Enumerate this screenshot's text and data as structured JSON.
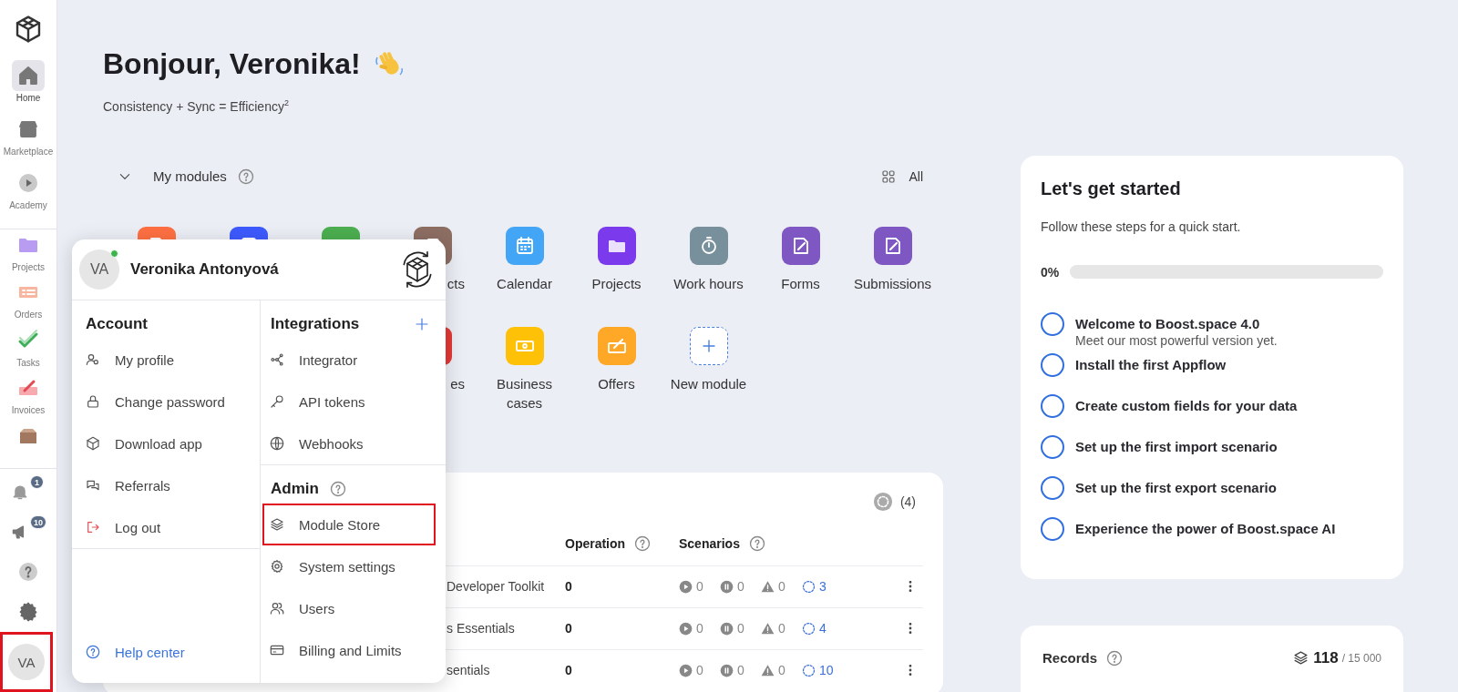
{
  "sidebar": {
    "items": [
      {
        "label": "Home",
        "selected": true
      },
      {
        "label": "Marketplace",
        "selected": false
      },
      {
        "label": "Academy",
        "selected": false
      },
      {
        "label": "Projects",
        "selected": false
      },
      {
        "label": "Orders",
        "selected": false
      },
      {
        "label": "Tasks",
        "selected": false
      },
      {
        "label": "Invoices",
        "selected": false
      },
      {
        "selected": false
      }
    ],
    "notifications_badge": "1",
    "announcements_badge": "10",
    "avatar": {
      "initials": "VA",
      "highlighted": true
    }
  },
  "greeting": {
    "title": "Bonjour, Veronika!",
    "subtitle": "Consistency + Sync = Efficiency$^{2}$"
  },
  "modules": {
    "title": "My modules",
    "expanded": true,
    "all_link": "All",
    "rows": [
      [
        {
          "kind": "module",
          "color": "#ff7043"
        },
        {
          "kind": "module",
          "color": "#3d5afe"
        },
        {
          "kind": "module",
          "color": "#4caf50"
        },
        {
          "kind": "module",
          "label": "cts",
          "color": "#8d6e63"
        },
        {
          "kind": "module",
          "label": "Calendar",
          "color": "#42a5f5"
        },
        {
          "kind": "module",
          "label": "Projects",
          "color": "#7c3aed"
        },
        {
          "kind": "module",
          "label": "Work hours",
          "color": "#78909c"
        },
        {
          "kind": "module",
          "label": "Forms",
          "color": "#7e57c2"
        },
        {
          "kind": "module",
          "label": "Submissions",
          "color": "#7e57c2"
        }
      ],
      [
        "",
        "",
        "",
        {
          "kind": "module",
          "label": "es",
          "color": "#e53935"
        },
        {
          "kind": "module",
          "label": "Business cases",
          "color": "#ffc107"
        },
        {
          "kind": "module",
          "label": "Offers",
          "color": "#ffa726"
        },
        {
          "kind": "new",
          "label": "New module"
        }
      ]
    ]
  },
  "spaces": {
    "count": "(4)",
    "columns": [
      "Operation",
      "Scenarios"
    ],
    "rows": [
      {
        "name": "Developer Toolkit",
        "operations": "0",
        "active": "0",
        "paused": "0",
        "errors": "0",
        "scenarios": "3"
      },
      {
        "name": "s Essentials",
        "operations": "0",
        "active": "0",
        "paused": "0",
        "errors": "0",
        "scenarios": "4"
      },
      {
        "name": "sentials",
        "operations": "0",
        "active": "0",
        "paused": "0",
        "errors": "0",
        "scenarios": "10"
      }
    ]
  },
  "popup": {
    "user": {
      "initials": "VA",
      "name": "Veronika Antonyová",
      "online": true
    },
    "account": {
      "title": "Account",
      "items": [
        {
          "label": "My profile",
          "kind": "normal"
        },
        {
          "label": "Change password",
          "kind": "normal"
        },
        {
          "label": "Download app",
          "kind": "normal"
        },
        {
          "label": "Referrals",
          "kind": "normal"
        },
        {
          "label": "Log out",
          "kind": "danger"
        }
      ]
    },
    "help_link": "Help center",
    "integrations": {
      "title": "Integrations",
      "items": [
        "Integrator",
        "API tokens",
        "Webhooks"
      ]
    },
    "admin": {
      "title": "Admin",
      "items": [
        {
          "label": "Module Store",
          "highlighted": true
        },
        {
          "label": "System settings",
          "highlighted": false
        },
        {
          "label": "Users",
          "highlighted": false
        },
        {
          "label": "Billing and Limits",
          "highlighted": false
        }
      ]
    }
  },
  "started": {
    "title": "Let's get started",
    "subtitle": "Follow these steps for a quick start.",
    "progress": {
      "reading": "0%",
      "level": 0
    },
    "steps": [
      {
        "title": "Welcome to Boost.space 4.0",
        "subtitle": "Meet our most powerful version yet.",
        "done": false
      },
      {
        "title": "Install the first Appflow",
        "done": false
      },
      {
        "title": "Create custom fields for your data",
        "done": false
      },
      {
        "title": "Set up the first import scenario",
        "done": false
      },
      {
        "title": "Set up the first export scenario",
        "done": false
      },
      {
        "title": "Experience the power of Boost.space AI",
        "done": false
      }
    ]
  },
  "usage": {
    "label": "Records",
    "value": "118",
    "limit": "/ 15 000"
  }
}
